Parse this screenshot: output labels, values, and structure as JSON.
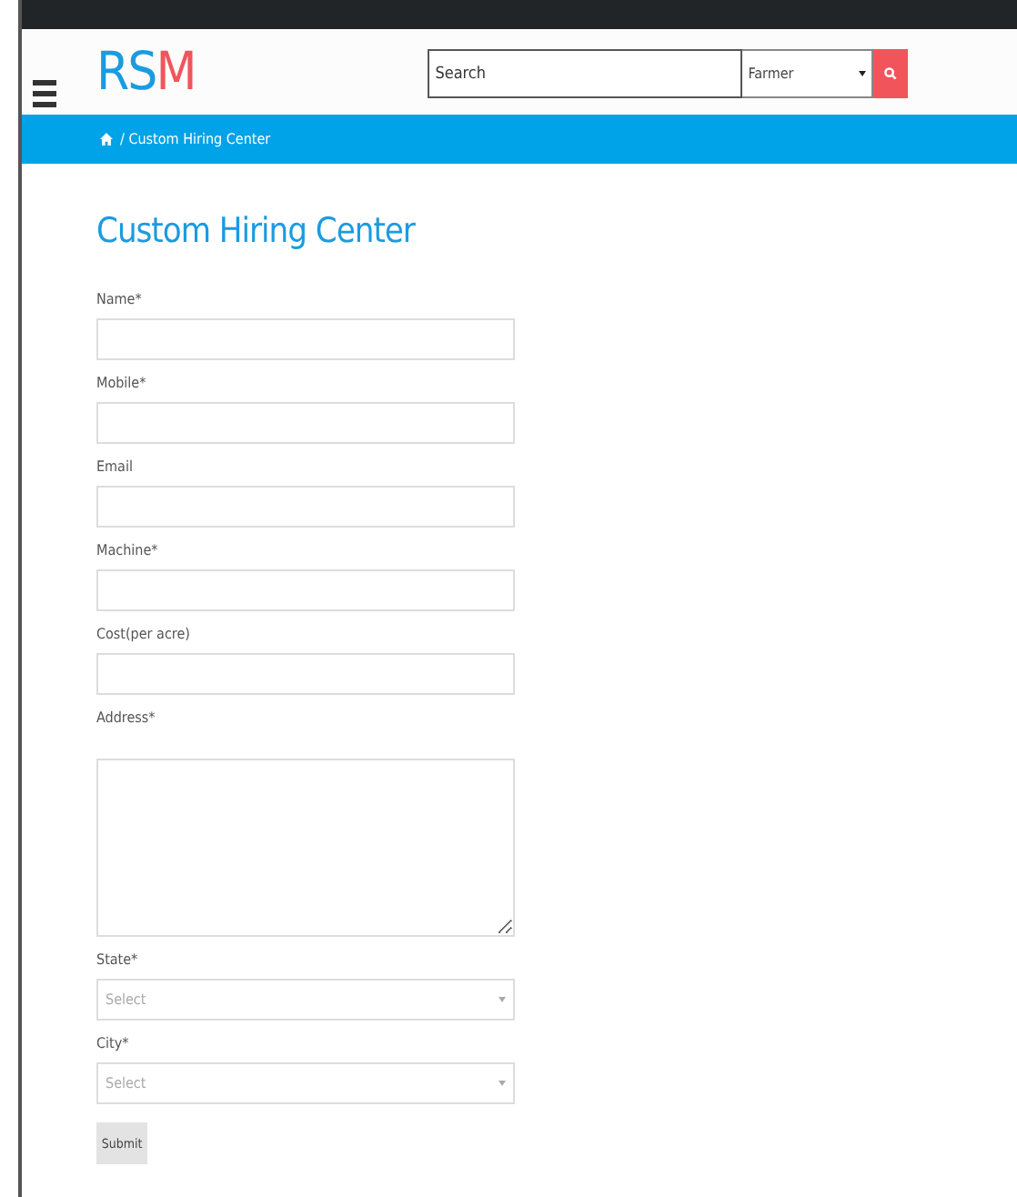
{
  "header": {
    "logo": [
      {
        "text": "RS",
        "color": "#1b9be0"
      },
      {
        "text": "M",
        "color": "#f2545b"
      }
    ],
    "search": {
      "placeholder": "Search"
    },
    "category": {
      "value": "Farmer"
    }
  },
  "breadcrumb": {
    "current": "/ Custom Hiring Center"
  },
  "page": {
    "title": "Custom Hiring Center"
  },
  "form": {
    "fields": [
      {
        "kind": "input",
        "label": "Name*"
      },
      {
        "kind": "input",
        "label": "Mobile*"
      },
      {
        "kind": "input",
        "label": "Email"
      },
      {
        "kind": "input",
        "label": "Machine*"
      },
      {
        "kind": "input",
        "label": "Cost(per acre)"
      },
      {
        "kind": "textarea",
        "label": "Address*"
      },
      {
        "kind": "select",
        "label": "State*",
        "placeholder": "Select"
      },
      {
        "kind": "select",
        "label": "City*",
        "placeholder": "Select"
      }
    ],
    "submit": "Submit"
  }
}
